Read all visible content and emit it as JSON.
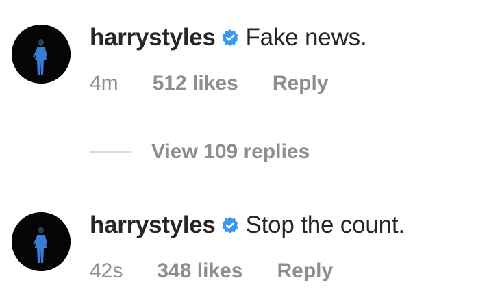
{
  "comments": [
    {
      "username": "harrystyles",
      "verified_icon": "verified-badge-icon",
      "text": "Fake news.",
      "time": "4m",
      "likes": "512 likes",
      "reply_label": "Reply"
    },
    {
      "username": "harrystyles",
      "verified_icon": "verified-badge-icon",
      "text": "Stop the count.",
      "time": "42s",
      "likes": "348 likes",
      "reply_label": "Reply"
    }
  ],
  "view_replies_label": "View 109 replies",
  "colors": {
    "text_primary": "#262626",
    "text_secondary": "#8e8e8e",
    "verified_blue": "#3897f0",
    "divider": "#dbdbdb",
    "avatar_bg": "#050505",
    "avatar_figure": "#3a7bd5"
  }
}
